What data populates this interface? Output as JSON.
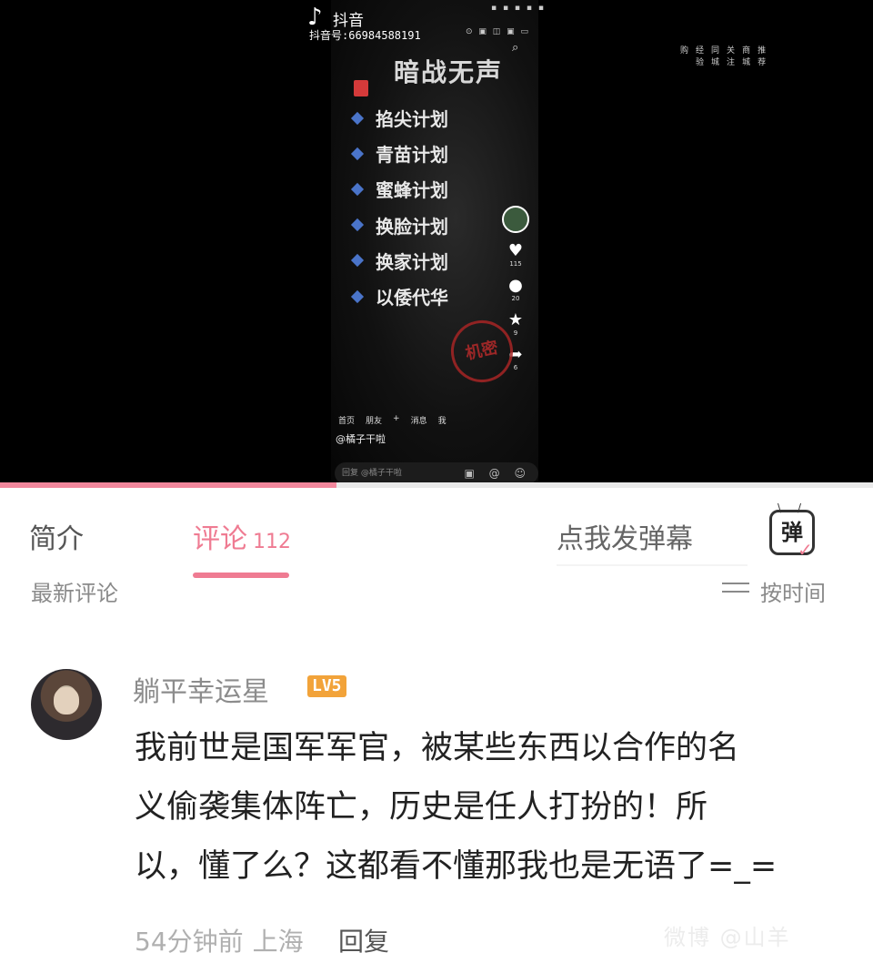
{
  "video": {
    "app_name": "抖音",
    "logo_icon": "♪",
    "douyin_id": "抖音号:66984588191",
    "status_icons": "▪ ▪ ▪ ▪ ▪",
    "status_icons2": "⊙ ▣ ◫ ▣ ▭",
    "top_tabs": [
      "购",
      "经验",
      "同城",
      "关注",
      "商城",
      "推荐"
    ],
    "title": "暗战无声",
    "plans": [
      "掐尖计划",
      "青苗计划",
      "蜜蜂计划",
      "换脸计划",
      "换家计划",
      "以倭代华"
    ],
    "side_counts": {
      "likes": "115",
      "comments": "20",
      "favorites": "9",
      "shares": "6"
    },
    "stamp_text": "机密",
    "author": "@橘子干啦",
    "bottom_nav": [
      "首页",
      "朋友",
      "+",
      "消息",
      "我"
    ],
    "reply_placeholder": "回复 @橘子干啦",
    "reply_icons": "▣ @ ☺",
    "progress": 0.385
  },
  "tabs": {
    "intro": "简介",
    "comments": "评论",
    "comments_count": "112",
    "danmaku_placeholder": "点我发弹幕",
    "danmaku_button": "弹",
    "danmaku_check": "✓"
  },
  "sort": {
    "latest": "最新评论",
    "by_time": "按时间"
  },
  "comment": {
    "username": "躺平幸运星",
    "level": "LV5",
    "lines": [
      "我前世是国军军官，被某些东西以合作的名",
      "义偷袭集体阵亡，历史是任人打扮的！所",
      "以，懂了么？这都看不懂那我也是无语了=_="
    ],
    "time": "54分钟前",
    "location": "上海",
    "reply_label": "回复"
  },
  "watermark": "微博 @山羊"
}
